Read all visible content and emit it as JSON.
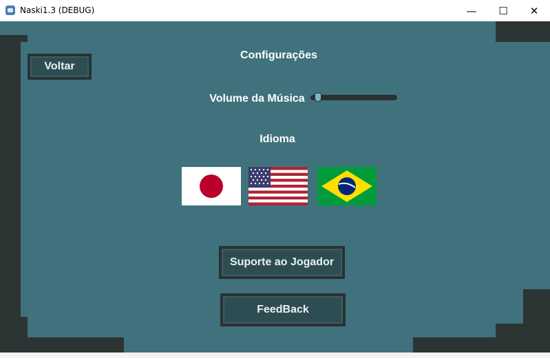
{
  "window": {
    "title": "Naski1.3 (DEBUG)",
    "minimize_glyph": "—",
    "maximize_glyph": "☐",
    "close_glyph": "✕"
  },
  "settings": {
    "heading": "Configurações",
    "back_label": "Voltar",
    "music_volume_label": "Volume da Música",
    "music_volume_value": 0.05,
    "language_label": "Idioma",
    "languages": [
      "japanese-flag",
      "us-flag",
      "brazil-flag"
    ],
    "support_label": "Suporte ao Jogador",
    "feedback_label": "FeedBack"
  },
  "colors": {
    "background_dark": "#2d3434",
    "panel_teal": "#3f727c",
    "button_fill": "#2e4d53",
    "text": "#ffffff"
  }
}
